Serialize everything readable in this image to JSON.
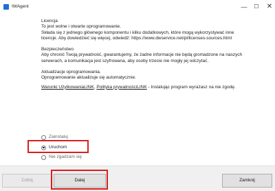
{
  "window": {
    "title": "IWAgent",
    "minimize": "—",
    "maximize": "☐",
    "close": "✕"
  },
  "license": {
    "heading": "Licencja",
    "lines": [
      "To jest wolne i otwarte oprogramowanie.",
      "Składa się z jednego głównego komponentu i kilku dodatkowych, które mogą wykorzystywać inne",
      "licencje. Aby dowiedzieć się więcej, odwiedź: https://www.dwservice.net/pl/licenses-sources.html"
    ]
  },
  "security": {
    "heading": "Bezpieczeństwo",
    "lines": [
      "Aby chronić Twoją prywatność, gwarantujemy, że żadne informacje nie będą gromadzone na naszych",
      "serwerach, a komunikacja jest szyfrowana, aby osoby trzecie nie mogły jej odczytać."
    ]
  },
  "update": {
    "heading": "Aktualizacje oprogramowania.",
    "line": "Oprogramowanie aktualizuje się automatycznie."
  },
  "terms": {
    "link1": "Warunki UżytkowaniaLINK",
    "separator": ", ",
    "link2": "Polityka prywatnościLINK",
    "suffix": " - Instalując program wyrażasz na nie zgodę."
  },
  "options": {
    "install": "Zainstaluj",
    "run": "Uruchom",
    "disagree": "Nie zgadzam się",
    "selected": "run"
  },
  "buttons": {
    "back": "Cofnij",
    "next": "Dalej",
    "close": "Zamknij"
  }
}
